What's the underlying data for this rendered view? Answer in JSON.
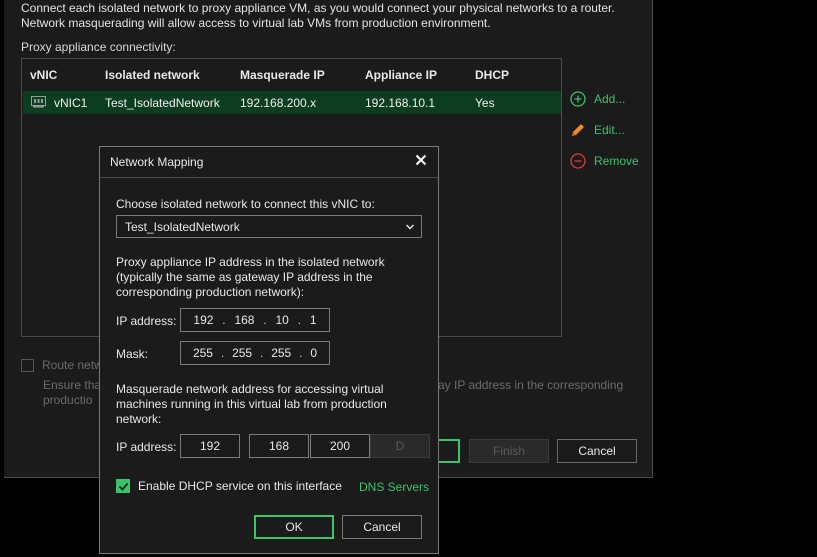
{
  "wizard": {
    "description_line1": "Connect each isolated network to proxy appliance VM, as you would connect your physical networks to a router.",
    "description_line2": "Network masquerading will allow access to virtual lab VMs from production environment.",
    "connectivity_label": "Proxy appliance connectivity:",
    "grid": {
      "columns": [
        "vNIC",
        "Isolated network",
        "Masquerade IP",
        "Appliance IP",
        "DHCP"
      ],
      "rows": [
        {
          "vnic": "vNIC1",
          "isolated_network": "Test_IsolatedNetwork",
          "masquerade_ip": "192.168.200.x",
          "appliance_ip": "192.168.10.1",
          "dhcp": "Yes"
        }
      ]
    },
    "actions": {
      "add": "Add...",
      "edit": "Edit...",
      "remove": "Remove"
    },
    "route_label_partial": "Route netw",
    "ensure_partial_left_line1": "Ensure tha",
    "ensure_partial_left_line2": "productio",
    "ensure_partial_right": "ay IP address in the corresponding",
    "buttons": {
      "finish": "Finish",
      "cancel": "Cancel"
    }
  },
  "modal": {
    "title": "Network Mapping",
    "choose_label": "Choose isolated network to connect this vNIC to:",
    "selected_network": "Test_IsolatedNetwork",
    "proxy_ip_label_line1": "Proxy appliance IP address in the isolated network",
    "proxy_ip_label_line2": "(typically the same as gateway IP address in the",
    "proxy_ip_label_line3": "corresponding production network):",
    "ip_address_label": "IP address:",
    "mask_label": "Mask:",
    "ip_octets": [
      "192",
      "168",
      "10",
      "1"
    ],
    "mask_octets": [
      "255",
      "255",
      "255",
      "0"
    ],
    "masq_label_line1": "Masquerade network address for accessing virtual",
    "masq_label_line2": "machines running in this virtual lab from production",
    "masq_label_line3": "network:",
    "masq_ip_label": "IP address:",
    "masq_octets": [
      "192",
      "168",
      "200",
      "D"
    ],
    "dhcp_label": "Enable DHCP service on this interface",
    "dhcp_checked": true,
    "dns_link": "DNS Servers",
    "ok": "OK",
    "cancel": "Cancel"
  },
  "colors": {
    "accent": "#3cc36a",
    "remove": "#e0393e",
    "edit": "#f08a24",
    "row_selected": "#0c3d20"
  }
}
